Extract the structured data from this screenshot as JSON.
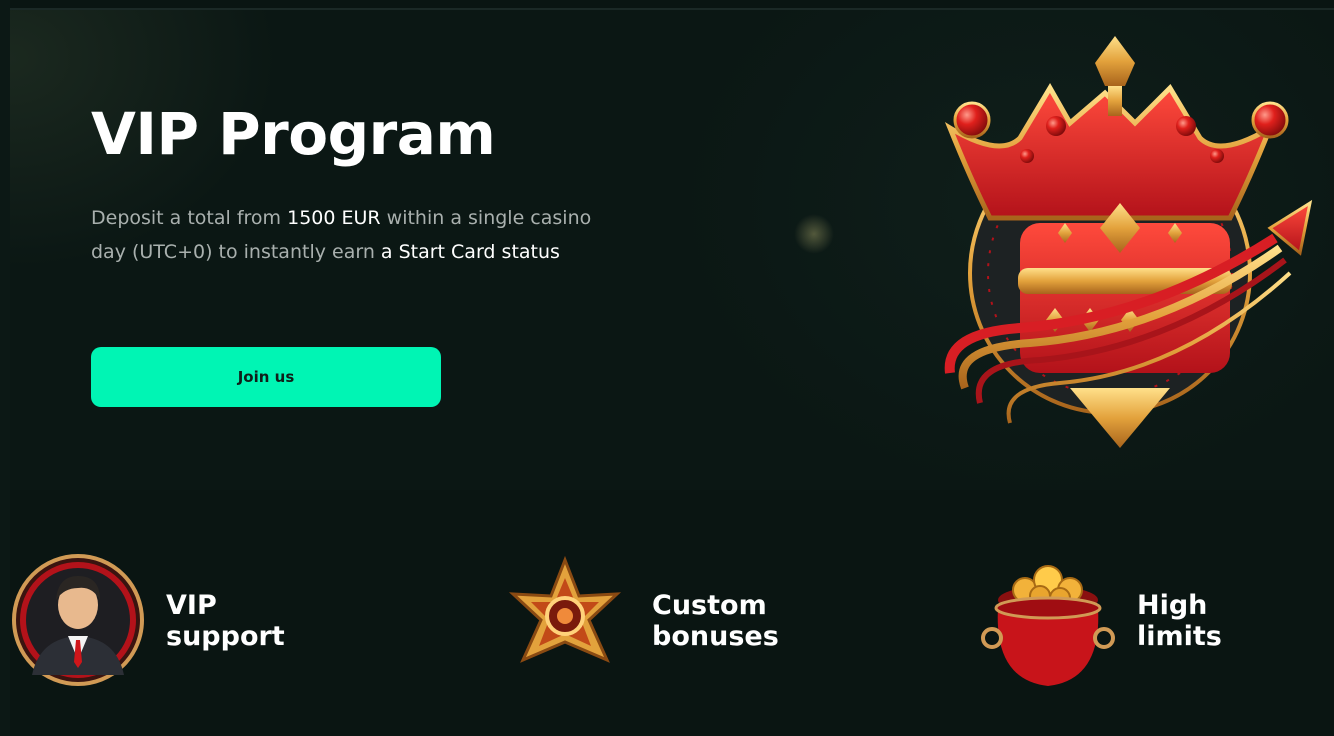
{
  "hero": {
    "title": "VIP Program",
    "description": {
      "part1": "Deposit a total from ",
      "amount": "1500 EUR",
      "part2": " within a single casino day (UTC+0) to instantly earn ",
      "status": "a Start Card",
      "part3": " status"
    },
    "join_button": "Join us",
    "image": "crown-icon"
  },
  "features": [
    {
      "line1": "VIP",
      "line2": "support",
      "icon": "vip-manager-icon"
    },
    {
      "line1": "Custom",
      "line2": "bonuses",
      "icon": "star-badge-icon"
    },
    {
      "line1": "High",
      "line2": "limits",
      "icon": "coin-pot-icon"
    }
  ],
  "colors": {
    "background": "#0a1512",
    "accent": "#00f5b4",
    "text_muted": "#a9b0ae",
    "text": "#ffffff"
  }
}
